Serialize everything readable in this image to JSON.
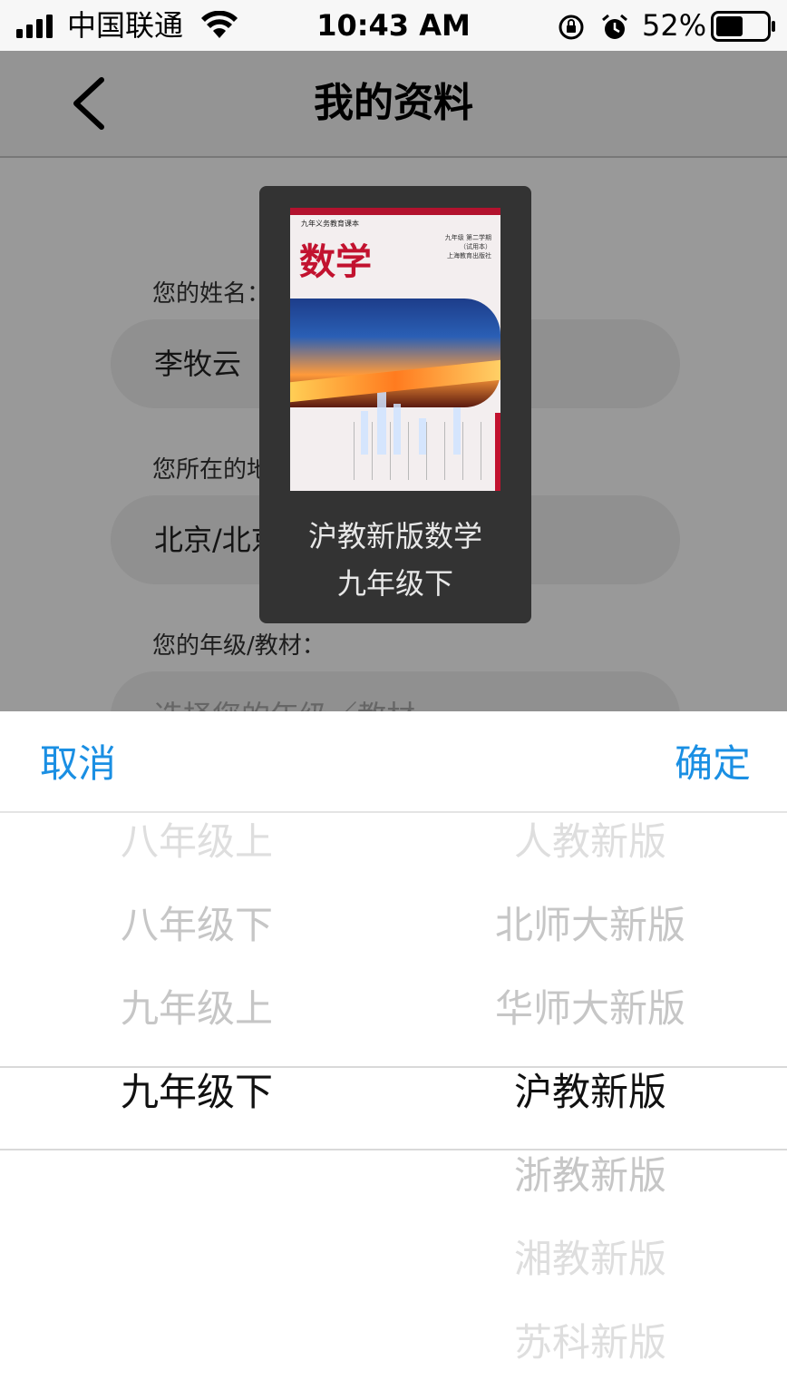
{
  "status_bar": {
    "carrier": "中国联通",
    "time": "10:43 AM",
    "battery_percent": "52%",
    "battery_level": 0.52
  },
  "nav": {
    "title": "我的资料"
  },
  "form": {
    "name_label": "您的姓名：",
    "name_value": "李牧云",
    "region_label": "您所在的地区：",
    "region_value": "北京/北京/海淀区",
    "grade_label": "您的年级/教材：",
    "grade_placeholder": "选择您的年级／教材"
  },
  "toast": {
    "cover": {
      "series": "九年义务教育课本",
      "subject": "数学",
      "grade_info": "九年级 第二学期",
      "edition_note": "（试用本）",
      "publisher": "上海教育出版社"
    },
    "caption_line1": "沪教新版数学",
    "caption_line2": "九年级下"
  },
  "picker": {
    "cancel_label": "取消",
    "confirm_label": "确定",
    "grades": [
      "八年级上",
      "八年级下",
      "九年级上",
      "九年级下"
    ],
    "selected_grade": "九年级下",
    "editions": [
      "人教新版",
      "北师大新版",
      "华师大新版",
      "沪教新版",
      "浙教新版",
      "湘教新版",
      "苏科新版"
    ],
    "selected_edition": "沪教新版"
  }
}
